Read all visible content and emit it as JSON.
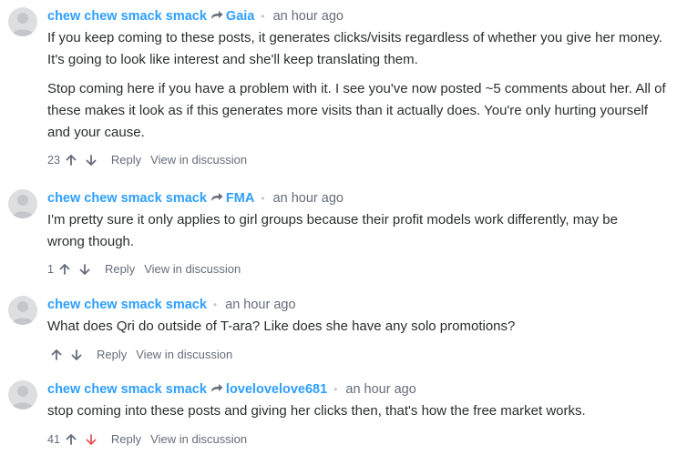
{
  "comments": [
    {
      "author": "chew chew smack smack",
      "reply_to": "Gaia",
      "time": "an hour ago",
      "paragraphs": [
        [
          "If you keep coming to these posts, it generates clicks/visits regardless of whether you give her money.",
          "It's going to look like interest and she'll keep translating them."
        ],
        [
          "Stop coming here if you have a problem with it. I see you've now posted ~5 comments about her. All of",
          "these makes it look as if this generates more visits than it actually does. You're only hurting yourself",
          "and your cause."
        ]
      ],
      "votes": "23",
      "downvote_active": false,
      "reply_label": "Reply",
      "view_label": "View in discussion"
    },
    {
      "author": "chew chew smack smack",
      "reply_to": "FMA",
      "time": "an hour ago",
      "paragraphs": [
        [
          "I'm pretty sure it only applies to girl groups because their profit models work differently, may be",
          "wrong though."
        ]
      ],
      "votes": "1",
      "downvote_active": false,
      "reply_label": "Reply",
      "view_label": "View in discussion"
    },
    {
      "author": "chew chew smack smack",
      "reply_to": "",
      "time": "an hour ago",
      "paragraphs": [
        [
          "What does Qri do outside of T-ara? Like does she have any solo promotions?"
        ]
      ],
      "votes": "",
      "downvote_active": false,
      "reply_label": "Reply",
      "view_label": "View in discussion"
    },
    {
      "author": "chew chew smack smack",
      "reply_to": "lovelovelove681",
      "time": "an hour ago",
      "paragraphs": [
        [
          "stop coming into these posts and giving her clicks then, that's how the free market works."
        ]
      ],
      "votes": "41",
      "downvote_active": true,
      "reply_label": "Reply",
      "view_label": "View in discussion"
    }
  ],
  "icons": {
    "avatar": "default-avatar-icon",
    "reply_to": "reply-arrow-icon",
    "upvote": "upvote-arrow-icon",
    "downvote": "downvote-arrow-icon"
  },
  "colors": {
    "link": "#2e9fff",
    "text": "#2a2e2e",
    "muted": "#656c7a",
    "downvote_active": "#e25757",
    "avatar_bg": "#dddee0"
  }
}
